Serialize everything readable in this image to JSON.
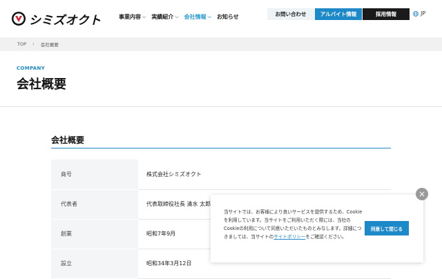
{
  "header": {
    "logo_text": "シミズオクト",
    "nav": [
      {
        "label": "事業内容"
      },
      {
        "label": "実績紹介"
      },
      {
        "label": "会社情報",
        "active": true
      },
      {
        "label": "お知らせ"
      }
    ],
    "contact_label": "お問い合わせ",
    "part_time_label": "アルバイト情報",
    "recruit_label": "採用情報",
    "lang_label": "JP"
  },
  "breadcrumb": {
    "top": "TOP",
    "current": "会社概要"
  },
  "page": {
    "en_label": "COMPANY",
    "title": "会社概要"
  },
  "section": {
    "title": "会社概要",
    "rows": [
      {
        "label": "商号",
        "value": "株式会社シミズオクト"
      },
      {
        "label": "代表者",
        "value": "代表取締役社長 清水 太郎"
      },
      {
        "label": "創業",
        "value": "昭和7年9月"
      },
      {
        "label": "設立",
        "value": "昭和34年3月12日"
      }
    ]
  },
  "cookie": {
    "text_before": "当サイトでは、お客様により良いサービスを提供するため、Cookieを利用しています。当サイトをご利用いただく際には、当社のCookieの利用について同意いただいたものとみなします。詳細につきましては、当サイトの",
    "link_label": "サイトポリシー",
    "text_after": "をご確認ください。",
    "agree_label": "同意して閉じる",
    "close_symbol": "×"
  },
  "colors": {
    "accent": "#1d89c8",
    "dark_button": "#1a1a1a",
    "breadcrumb_bg": "#f1f1f1",
    "table_header_bg": "#f3f5f6"
  }
}
